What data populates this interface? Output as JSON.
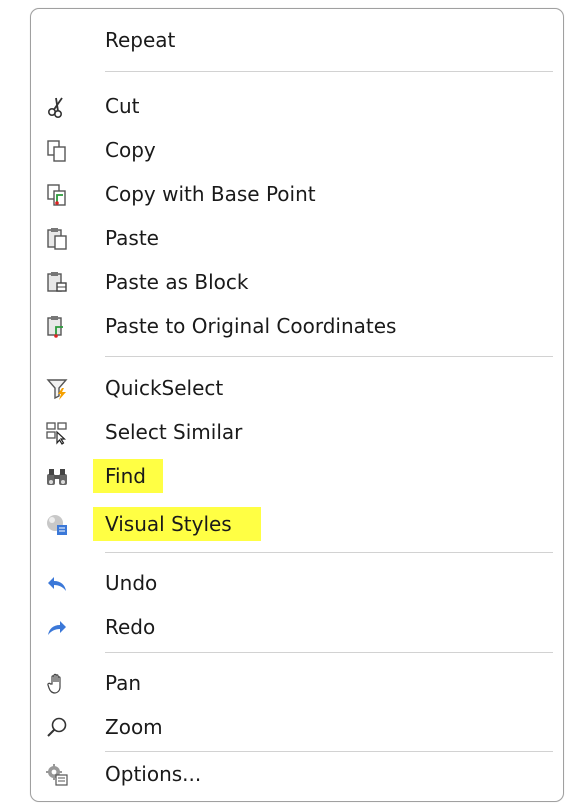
{
  "menu": {
    "items": [
      {
        "label": "Repeat"
      },
      {
        "label": "Cut",
        "icon": "scissors-icon"
      },
      {
        "label": "Copy",
        "icon": "copy-icon"
      },
      {
        "label": "Copy with Base Point",
        "icon": "copy-base-point-icon"
      },
      {
        "label": "Paste",
        "icon": "paste-icon"
      },
      {
        "label": "Paste as Block",
        "icon": "paste-as-block-icon"
      },
      {
        "label": "Paste to Original Coordinates",
        "icon": "paste-original-coordinates-icon"
      },
      {
        "label": "QuickSelect",
        "icon": "quickselect-funnel-icon"
      },
      {
        "label": "Select Similar",
        "icon": "select-similar-icon"
      },
      {
        "label": "Find",
        "icon": "binoculars-icon",
        "highlighted": true
      },
      {
        "label": "Visual Styles",
        "icon": "visual-styles-icon",
        "highlighted": true
      },
      {
        "label": "Undo",
        "icon": "undo-arrow-icon"
      },
      {
        "label": "Redo",
        "icon": "redo-arrow-icon"
      },
      {
        "label": "Pan",
        "icon": "pan-hand-icon"
      },
      {
        "label": "Zoom",
        "icon": "zoom-magnifier-icon"
      },
      {
        "label": "Options...",
        "icon": "options-gear-icon"
      }
    ],
    "highlight_color": "#ffff44",
    "accent_color": "#3b78d8"
  }
}
